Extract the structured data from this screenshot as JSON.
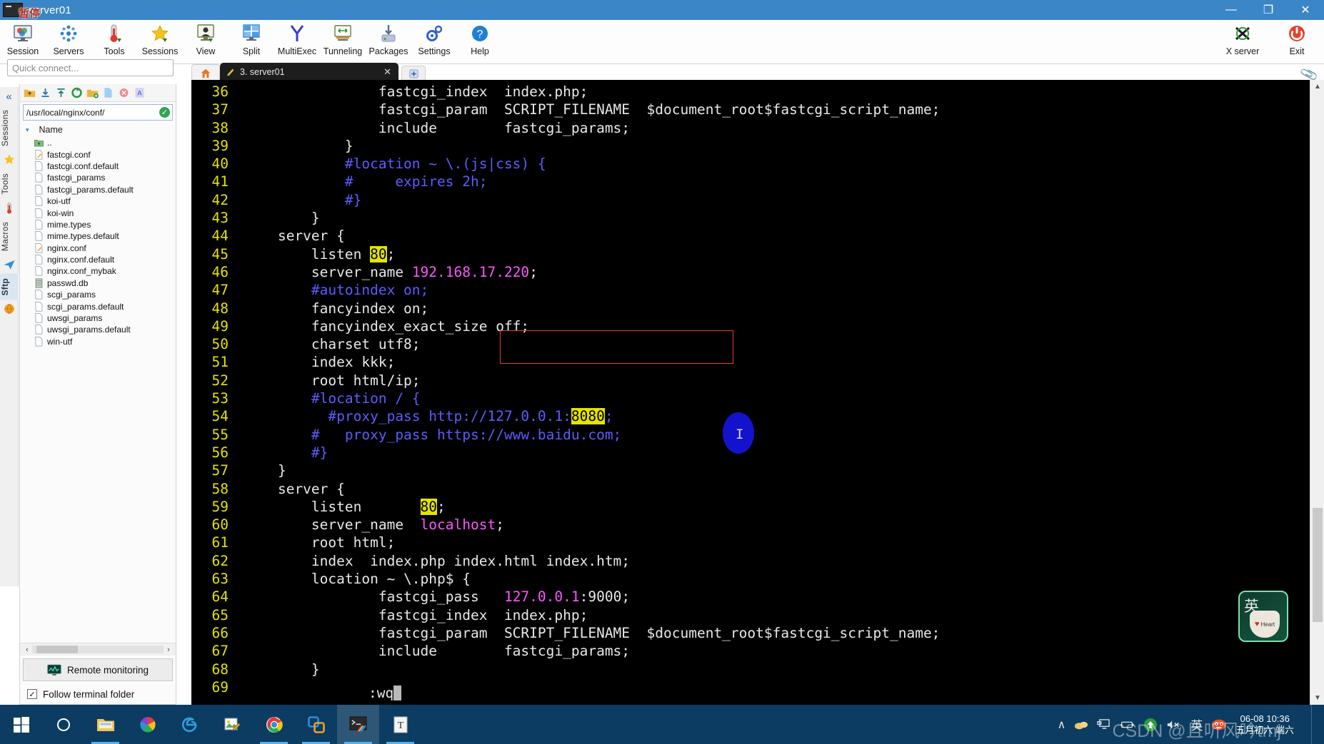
{
  "window": {
    "title": "server01",
    "cn_badge": "暂停",
    "minimize": "—",
    "maximize": "❐",
    "close": "✕"
  },
  "ribbon": {
    "items": [
      {
        "label": "Session",
        "icon": "session-icon"
      },
      {
        "label": "Servers",
        "icon": "servers-icon"
      },
      {
        "label": "Tools",
        "icon": "tools-icon"
      },
      {
        "label": "Sessions",
        "icon": "sessions-star-icon"
      },
      {
        "label": "View",
        "icon": "view-icon"
      },
      {
        "label": "Split",
        "icon": "split-icon"
      },
      {
        "label": "MultiExec",
        "icon": "multiexec-icon"
      },
      {
        "label": "Tunneling",
        "icon": "tunneling-icon"
      },
      {
        "label": "Packages",
        "icon": "packages-icon"
      },
      {
        "label": "Settings",
        "icon": "settings-gear-icon"
      },
      {
        "label": "Help",
        "icon": "help-icon"
      }
    ],
    "right_items": [
      {
        "label": "X server",
        "icon": "x-server-icon"
      },
      {
        "label": "Exit",
        "icon": "power-exit-icon"
      }
    ]
  },
  "quick_connect": {
    "placeholder": "Quick connect..."
  },
  "left_strip": {
    "collapse": "«",
    "tabs": [
      {
        "label": "Sessions",
        "selected": false
      },
      {
        "label": "Tools",
        "selected": false
      },
      {
        "label": "Macros",
        "selected": false
      },
      {
        "label": "Sftp",
        "selected": true
      }
    ]
  },
  "sftp": {
    "toolbar_icons": [
      "parent-folder-icon",
      "download-icon",
      "upload-icon",
      "refresh-icon",
      "new-folder-icon",
      "new-file-icon",
      "delete-icon",
      "text-mode-icon"
    ],
    "path": "/usr/local/nginx/conf/",
    "path_status": "✓",
    "column_header": "Name",
    "sort_arrow": "▾",
    "files": [
      {
        "name": "..",
        "type": "parent"
      },
      {
        "name": "fastcgi.conf",
        "type": "edited"
      },
      {
        "name": "fastcgi.conf.default",
        "type": "file"
      },
      {
        "name": "fastcgi_params",
        "type": "file"
      },
      {
        "name": "fastcgi_params.default",
        "type": "file"
      },
      {
        "name": "koi-utf",
        "type": "file"
      },
      {
        "name": "koi-win",
        "type": "file"
      },
      {
        "name": "mime.types",
        "type": "file"
      },
      {
        "name": "mime.types.default",
        "type": "file"
      },
      {
        "name": "nginx.conf",
        "type": "edited"
      },
      {
        "name": "nginx.conf.default",
        "type": "file"
      },
      {
        "name": "nginx.conf_mybak",
        "type": "file"
      },
      {
        "name": "passwd.db",
        "type": "db"
      },
      {
        "name": "scgi_params",
        "type": "file"
      },
      {
        "name": "scgi_params.default",
        "type": "file"
      },
      {
        "name": "uwsgi_params",
        "type": "file"
      },
      {
        "name": "uwsgi_params.default",
        "type": "file"
      },
      {
        "name": "win-utf",
        "type": "file"
      }
    ],
    "scroll_left": "‹",
    "scroll_right": "›",
    "remote_monitoring": "Remote monitoring",
    "follow_terminal_folder": "Follow terminal folder",
    "follow_checked": "✓"
  },
  "tabs": {
    "home_icon": "home-icon",
    "terminal_tab": {
      "label": "3. server01",
      "icon": "ssh-tab-icon",
      "close": "✕"
    },
    "new_tab": "+"
  },
  "terminal": {
    "vim_command": ":wq",
    "lines": [
      {
        "n": "36",
        "segs": [
          {
            "t": "                fastcgi_index  index.php;",
            "c": "c-white"
          }
        ]
      },
      {
        "n": "37",
        "segs": [
          {
            "t": "                fastcgi_param  SCRIPT_FILENAME  $document_root$fastcgi_script_name;",
            "c": "c-white"
          }
        ]
      },
      {
        "n": "38",
        "segs": [
          {
            "t": "                include        fastcgi_params;",
            "c": "c-white"
          }
        ]
      },
      {
        "n": "39",
        "segs": [
          {
            "t": "            }",
            "c": "c-white"
          }
        ]
      },
      {
        "n": "40",
        "segs": [
          {
            "t": "            #location ~ \\.(js|css) {",
            "c": "c-blue"
          }
        ]
      },
      {
        "n": "41",
        "segs": [
          {
            "t": "            #     expires 2h;",
            "c": "c-blue"
          }
        ]
      },
      {
        "n": "42",
        "segs": [
          {
            "t": "            #}",
            "c": "c-blue"
          }
        ]
      },
      {
        "n": "43",
        "segs": [
          {
            "t": "        }",
            "c": "c-white"
          }
        ]
      },
      {
        "n": "44",
        "segs": [
          {
            "t": "    server {",
            "c": "c-white"
          }
        ]
      },
      {
        "n": "45",
        "segs": [
          {
            "t": "        listen ",
            "c": "c-white"
          },
          {
            "t": "80",
            "c": "c-yellowhl"
          },
          {
            "t": ";",
            "c": "c-white"
          }
        ]
      },
      {
        "n": "46",
        "segs": [
          {
            "t": "        server_name ",
            "c": "c-white"
          },
          {
            "t": "192.168.17.220",
            "c": "c-pink"
          },
          {
            "t": ";",
            "c": "c-white"
          }
        ]
      },
      {
        "n": "47",
        "segs": [
          {
            "t": "        #autoindex on;",
            "c": "c-blue"
          }
        ]
      },
      {
        "n": "48",
        "segs": [
          {
            "t": "        fancyindex on;",
            "c": "c-white"
          }
        ]
      },
      {
        "n": "49",
        "segs": [
          {
            "t": "        fancyindex_exact_size off;",
            "c": "c-white"
          }
        ]
      },
      {
        "n": "50",
        "segs": [
          {
            "t": "        charset utf8;",
            "c": "c-white"
          }
        ]
      },
      {
        "n": "51",
        "segs": [
          {
            "t": "        index kkk;",
            "c": "c-white"
          }
        ]
      },
      {
        "n": "52",
        "segs": [
          {
            "t": "        root html/ip;",
            "c": "c-white"
          }
        ]
      },
      {
        "n": "53",
        "segs": [
          {
            "t": "        #location / {",
            "c": "c-blue"
          }
        ]
      },
      {
        "n": "54",
        "segs": [
          {
            "t": "          #proxy_pass http://127.0.0.1:",
            "c": "c-blue"
          },
          {
            "t": "8080",
            "c": "c-yellowhl"
          },
          {
            "t": ";",
            "c": "c-blue"
          }
        ]
      },
      {
        "n": "55",
        "segs": [
          {
            "t": "        #   proxy_pass https://www.baidu.com;",
            "c": "c-blue"
          }
        ]
      },
      {
        "n": "56",
        "segs": [
          {
            "t": "        #}",
            "c": "c-blue"
          }
        ]
      },
      {
        "n": "57",
        "segs": [
          {
            "t": "    }",
            "c": "c-white"
          }
        ]
      },
      {
        "n": "58",
        "segs": [
          {
            "t": "    server {",
            "c": "c-white"
          }
        ]
      },
      {
        "n": "59",
        "segs": [
          {
            "t": "        listen       ",
            "c": "c-white"
          },
          {
            "t": "80",
            "c": "c-yellowhl"
          },
          {
            "t": ";",
            "c": "c-white"
          }
        ]
      },
      {
        "n": "60",
        "segs": [
          {
            "t": "        server_name  ",
            "c": "c-white"
          },
          {
            "t": "localhost",
            "c": "c-pink"
          },
          {
            "t": ";",
            "c": "c-white"
          }
        ]
      },
      {
        "n": "61",
        "segs": [
          {
            "t": "        root html;",
            "c": "c-white"
          }
        ]
      },
      {
        "n": "62",
        "segs": [
          {
            "t": "        index  index.php index.html index.htm;",
            "c": "c-white"
          }
        ]
      },
      {
        "n": "63",
        "segs": [
          {
            "t": "        location ~ \\.php$ {",
            "c": "c-white"
          }
        ]
      },
      {
        "n": "64",
        "segs": [
          {
            "t": "                fastcgi_pass   ",
            "c": "c-white"
          },
          {
            "t": "127.0.0.1",
            "c": "c-pink"
          },
          {
            "t": ":9000;",
            "c": "c-white"
          }
        ]
      },
      {
        "n": "65",
        "segs": [
          {
            "t": "                fastcgi_index  index.php;",
            "c": "c-white"
          }
        ]
      },
      {
        "n": "66",
        "segs": [
          {
            "t": "                fastcgi_param  SCRIPT_FILENAME  $document_root$fastcgi_script_name;",
            "c": "c-white"
          }
        ]
      },
      {
        "n": "67",
        "segs": [
          {
            "t": "                include        fastcgi_params;",
            "c": "c-white"
          }
        ]
      },
      {
        "n": "68",
        "segs": [
          {
            "t": "        }",
            "c": "c-white"
          }
        ]
      },
      {
        "n": "69",
        "segs": [
          {
            "t": "",
            "c": "c-white"
          }
        ]
      }
    ]
  },
  "ime_widget": {
    "mode": "英",
    "heart": "♥",
    "text": "Heart"
  },
  "taskbar": {
    "items": [
      {
        "icon": "windows-start-icon",
        "active": false,
        "running": false
      },
      {
        "icon": "cortana-search-icon",
        "active": false,
        "running": false
      },
      {
        "icon": "file-explorer-icon",
        "active": false,
        "running": true
      },
      {
        "icon": "pinwheel-browser-icon",
        "active": false,
        "running": false
      },
      {
        "icon": "edge-browser-icon",
        "active": false,
        "running": false
      },
      {
        "icon": "image-editor-icon",
        "active": false,
        "running": false
      },
      {
        "icon": "chrome-browser-icon",
        "active": false,
        "running": true
      },
      {
        "icon": "vmware-workstation-icon",
        "active": false,
        "running": true
      },
      {
        "icon": "mobaxterm-icon",
        "active": true,
        "running": true
      },
      {
        "icon": "typora-icon",
        "active": false,
        "running": true
      }
    ],
    "tray": [
      {
        "icon": "show-hidden-icons-chevron",
        "glyph": "∧"
      },
      {
        "icon": "onedrive-cloud-icon",
        "glyph": ""
      },
      {
        "icon": "network-monitor-icon",
        "glyph": ""
      },
      {
        "icon": "battery-icon",
        "glyph": ""
      },
      {
        "icon": "update-arrow-icon",
        "glyph": "↑"
      },
      {
        "icon": "volume-muted-icon",
        "glyph": "⏷✕"
      },
      {
        "icon": "ime-english-icon",
        "glyph": "英"
      },
      {
        "icon": "sogou-ime-icon",
        "glyph": ""
      }
    ],
    "clock_time": "06-08 10:36",
    "clock_lunar": "五月初六 端六",
    "watermark": "CSDN @且听风吟tmj"
  }
}
